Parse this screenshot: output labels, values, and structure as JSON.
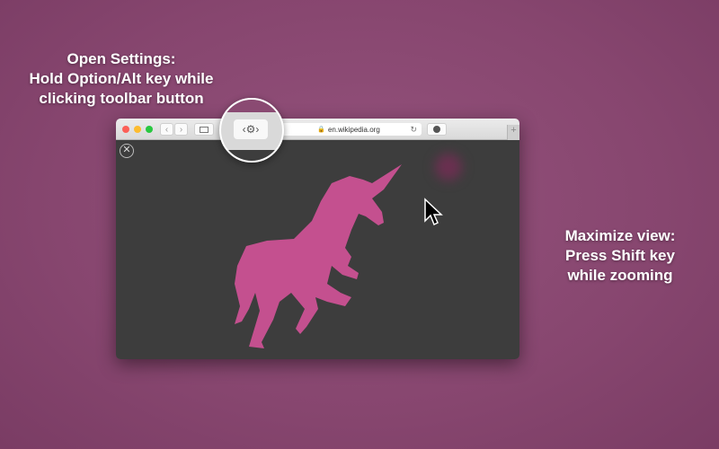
{
  "captions": {
    "settings": [
      "Open Settings:",
      "Hold Option/Alt key while",
      "clicking toolbar button"
    ],
    "maximize": [
      "Maximize view:",
      "Press Shift key",
      "while zooming"
    ]
  },
  "browser": {
    "url": "en.wikipedia.org",
    "icons": [
      "back-icon",
      "forward-icon",
      "sidebar-icon",
      "zoom-settings-icon",
      "lock-icon",
      "reload-icon",
      "download-icon",
      "new-tab-icon",
      "close-icon"
    ],
    "new_tab_label": "+"
  },
  "colors": {
    "background": "#87466f",
    "unicorn": "#c4508f",
    "content": "#3d3d3d"
  }
}
